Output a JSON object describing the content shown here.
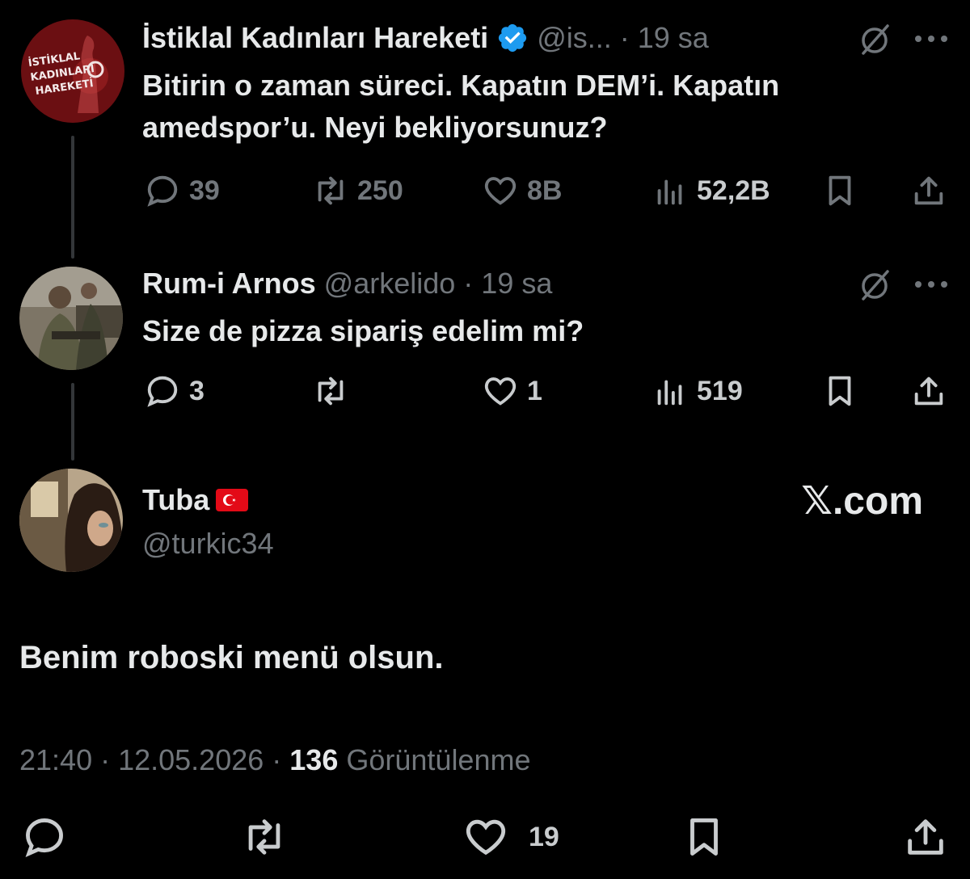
{
  "tweets": [
    {
      "name": "İstiklal Kadınları Hareketi",
      "handle": "@is...",
      "time": "19 sa",
      "text_line1": "Bitirin o zaman süreci. Kapatın DEM’i. Kapatın",
      "text_line2": "amedspor’u. Neyi bekliyorsunuz?",
      "avatar_text": [
        "İSTİKLAL",
        "KADINLARI",
        "HAREKETİ"
      ],
      "replies": "39",
      "reposts": "250",
      "likes": "8B",
      "views": "52,2B"
    },
    {
      "name": "Rum-i Arnos",
      "handle": "@arkelido",
      "time": "19 sa",
      "text": "Size de pizza sipariş edelim mi?",
      "replies": "3",
      "reposts": "",
      "likes": "1",
      "views": "519"
    }
  ],
  "main": {
    "name": "Tuba",
    "handle": "@turkic34",
    "text": "Benim roboski menü olsun.",
    "time": "21:40",
    "date": "12.05.2026",
    "views_count": "136",
    "views_label": "Görüntülenme",
    "likes": "19",
    "watermark": "𝕏.com"
  },
  "separator": "·",
  "colors": {
    "background": "#000000",
    "text": "#e7e9ea",
    "muted": "#71767b",
    "verified": "#1d9bf0",
    "flag_red": "#e30a17"
  }
}
